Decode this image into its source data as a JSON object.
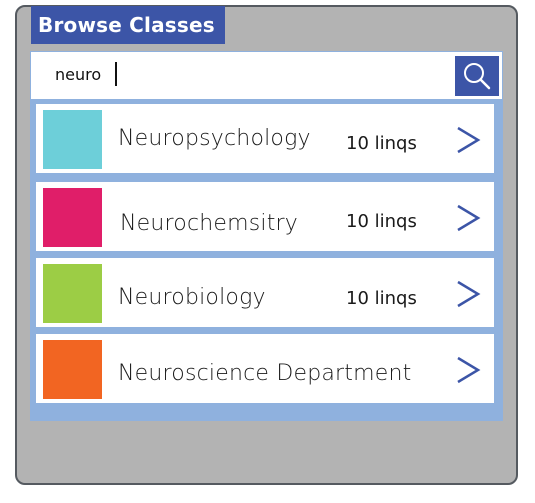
{
  "header": {
    "title": "Browse Classes"
  },
  "search": {
    "value": "neuro",
    "icon": "search-icon"
  },
  "colors": {
    "frame_bg": "#b3b3b3",
    "panel_bg": "#8fb1de",
    "accent": "#3c55a7"
  },
  "classes": [
    {
      "name": "Neuropsychology",
      "count": "10 linqs",
      "color": "#6dcfd9"
    },
    {
      "name": "Neurochemsitry",
      "count": "10 linqs",
      "color": "#e01e69"
    },
    {
      "name": "Neurobiology",
      "count": "10 linqs",
      "color": "#9ccd45"
    },
    {
      "name": "Neuroscience Department",
      "count": "",
      "color": "#f26522"
    }
  ]
}
